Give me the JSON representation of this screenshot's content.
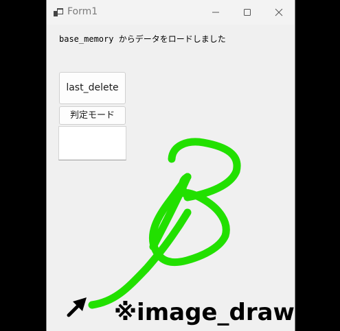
{
  "window": {
    "title": "Form1"
  },
  "titlebar": {
    "icons": [
      "app-icon",
      "minimize-icon",
      "maximize-icon",
      "close-icon"
    ]
  },
  "status": {
    "message": "base_memory からデータをロードしました"
  },
  "buttons": {
    "last_delete_label": "last_delete",
    "mode_label": "判定モード",
    "blank_label": ""
  },
  "annotation": {
    "caption": "※image_draw",
    "arrow_icon": "arrow-up-right-icon"
  },
  "drawing": {
    "stroke_color": "#22e000",
    "arrow_color": "#000000",
    "shape": "handwritten letter B"
  }
}
